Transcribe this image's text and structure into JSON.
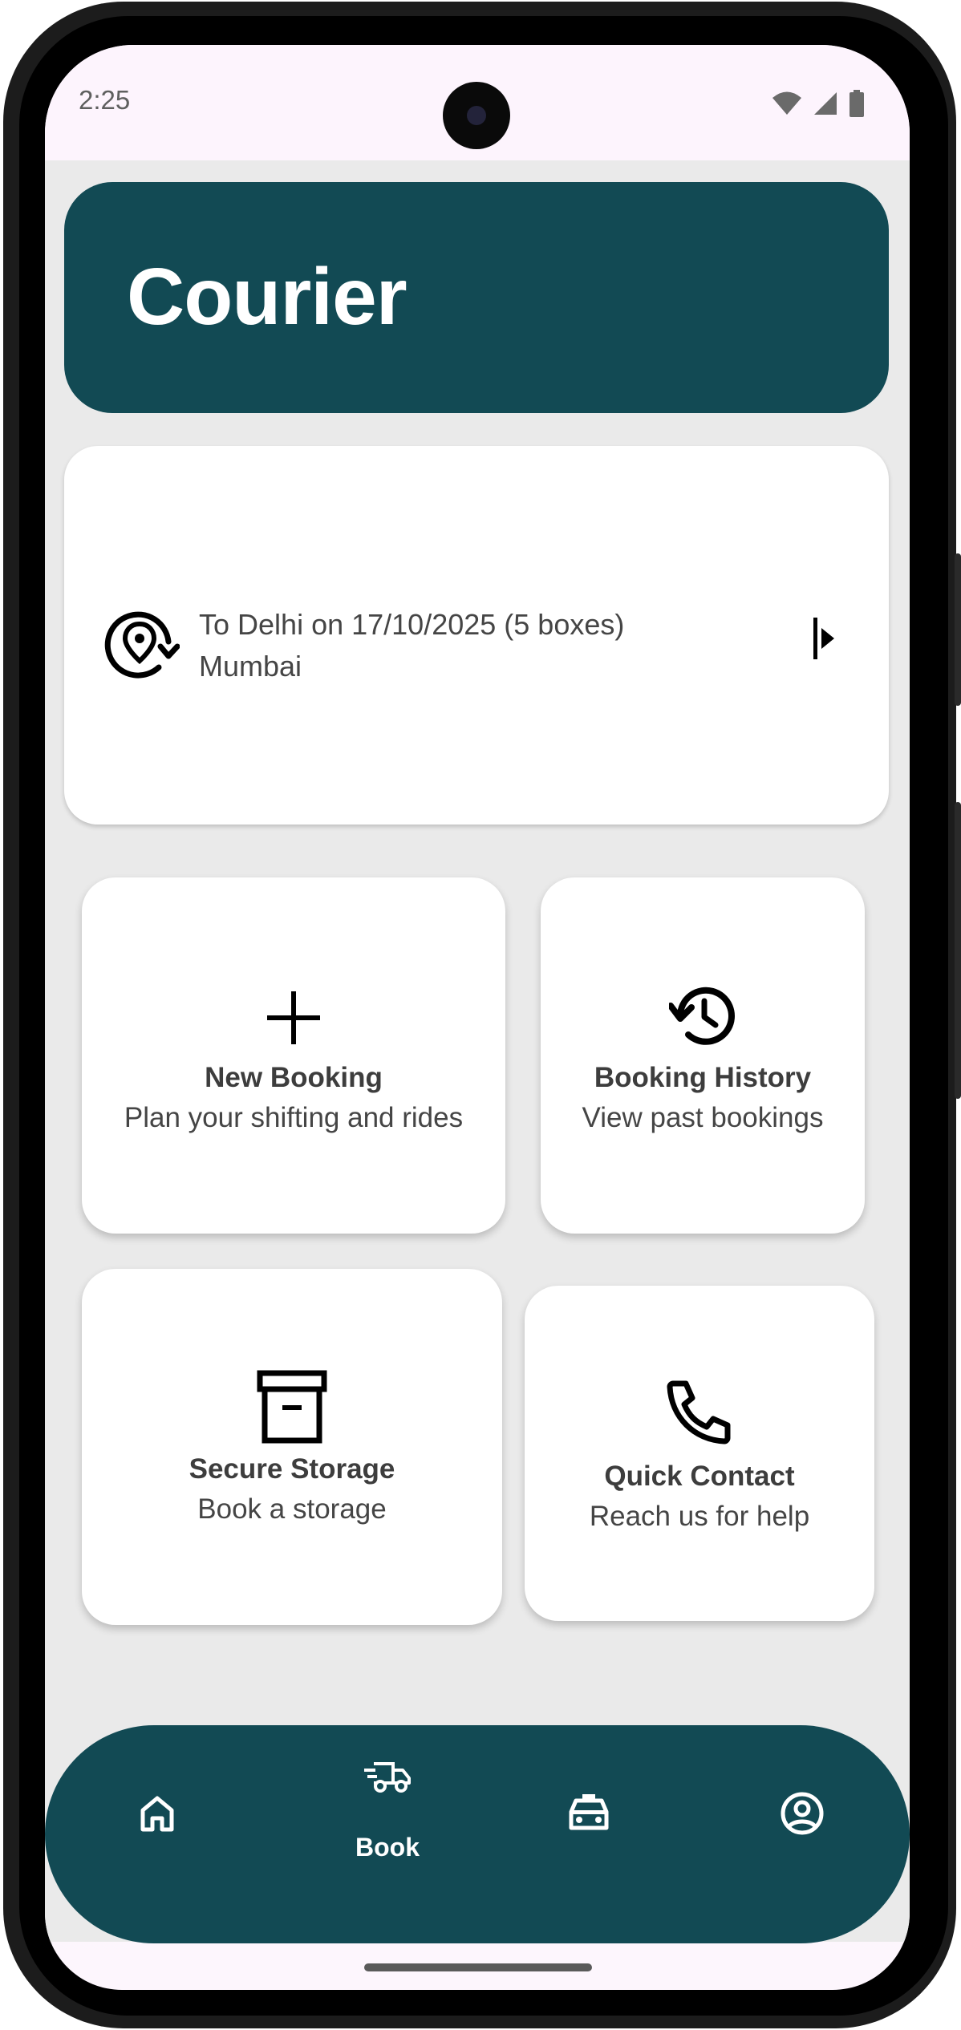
{
  "status_bar": {
    "time": "2:25",
    "icons": [
      "wifi-icon",
      "signal-icon",
      "battery-icon"
    ]
  },
  "header": {
    "title": "Courier"
  },
  "current_booking": {
    "icon": "location-refresh-icon",
    "line1": "To Delhi on 17/10/2025 (5 boxes)",
    "line2": "Mumbai",
    "action_icon": "play-arrow-icon"
  },
  "tiles": [
    {
      "icon": "plus-icon",
      "title": "New Booking",
      "subtitle": "Plan your shifting and rides"
    },
    {
      "icon": "history-icon",
      "title": "Booking History",
      "subtitle": "View past bookings"
    },
    {
      "icon": "archive-box-icon",
      "title": "Secure Storage",
      "subtitle": "Book a storage"
    },
    {
      "icon": "phone-icon",
      "title": "Quick Contact",
      "subtitle": "Reach us for help"
    }
  ],
  "bottom_nav": {
    "items": [
      {
        "icon": "home-icon",
        "label": ""
      },
      {
        "icon": "truck-icon",
        "label": "Book",
        "selected": true
      },
      {
        "icon": "taxi-icon",
        "label": ""
      },
      {
        "icon": "account-icon",
        "label": ""
      }
    ]
  },
  "colors": {
    "brand": "#124a54",
    "background": "#eaeaea",
    "card": "#ffffff"
  }
}
